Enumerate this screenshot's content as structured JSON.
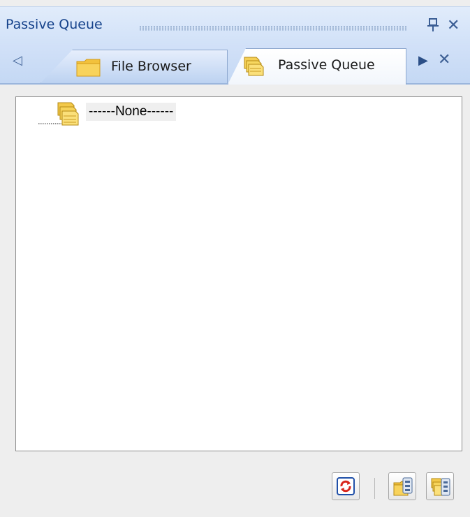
{
  "panel": {
    "title": "Passive Queue",
    "pin_glyph": "ᵽ",
    "close_glyph": "✕"
  },
  "tabs": {
    "scroll_left_glyph": "◁",
    "scroll_right_glyph": "▶",
    "close_glyph": "✕",
    "items": [
      {
        "label": "File Browser",
        "icon": "folder-icon",
        "active": false
      },
      {
        "label": "Passive Queue",
        "icon": "queue-stack-icon",
        "active": true
      }
    ]
  },
  "tree": {
    "nodes": [
      {
        "label": "------None------",
        "icon": "queue-stack-icon"
      }
    ]
  },
  "toolbar": {
    "buttons": [
      {
        "icon": "refresh-icon"
      },
      {
        "icon": "folder-settings-icon"
      },
      {
        "icon": "queue-settings-icon"
      }
    ]
  },
  "colors": {
    "accent": "#15428b",
    "titlebar": "#d6e4f9",
    "folder": "#f5c542"
  }
}
